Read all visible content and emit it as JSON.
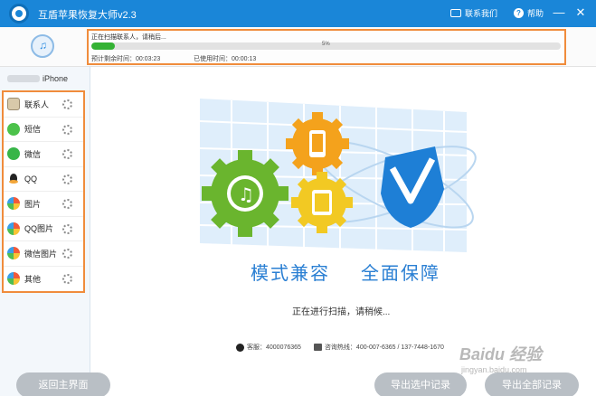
{
  "app": {
    "title": "互盾苹果恢复大师v2.3",
    "contact_label": "联系我们",
    "help_label": "帮助",
    "minimize": "—",
    "close": "✕"
  },
  "progress": {
    "status": "正在扫描联系人，请稍后...",
    "percent_label": "5%",
    "percent_value": 5,
    "remaining_label": "预计剩余时间：00:03:23",
    "used_label": "已使用时间：00:00:13",
    "fill_color": "#34b234",
    "border_color": "#f08c3c"
  },
  "sidebar": {
    "device": "iPhone",
    "categories": [
      {
        "label": "联系人",
        "icon": "contacts-icon"
      },
      {
        "label": "短信",
        "icon": "sms-icon"
      },
      {
        "label": "微信",
        "icon": "wechat-icon"
      },
      {
        "label": "QQ",
        "icon": "qq-icon"
      },
      {
        "label": "图片",
        "icon": "photo-icon"
      },
      {
        "label": "QQ图片",
        "icon": "photo-icon"
      },
      {
        "label": "微信图片",
        "icon": "photo-icon"
      },
      {
        "label": "其他",
        "icon": "photo-icon"
      }
    ]
  },
  "main": {
    "slogan_left": "模式兼容",
    "slogan_right": "全面保障",
    "scanning_text": "正在进行扫描，请稍候...",
    "qq_info": "客服：4000076365",
    "phone_info": "咨询热线：400-007-6365 / 137-7448-1670"
  },
  "buttons": {
    "back": "返回主界面",
    "export_selected": "导出选中记录",
    "export_all": "导出全部记录"
  },
  "watermark": {
    "brand": "Baidu 经验",
    "url": "jingyan.baidu.com"
  },
  "colors": {
    "titlebar": "#1a86d8",
    "accent_orange": "#f08c3c",
    "gear_green": "#6ab52e",
    "gear_orange": "#f4a21c",
    "gear_yellow": "#f2c923",
    "shield_blue": "#1e7fd6"
  }
}
